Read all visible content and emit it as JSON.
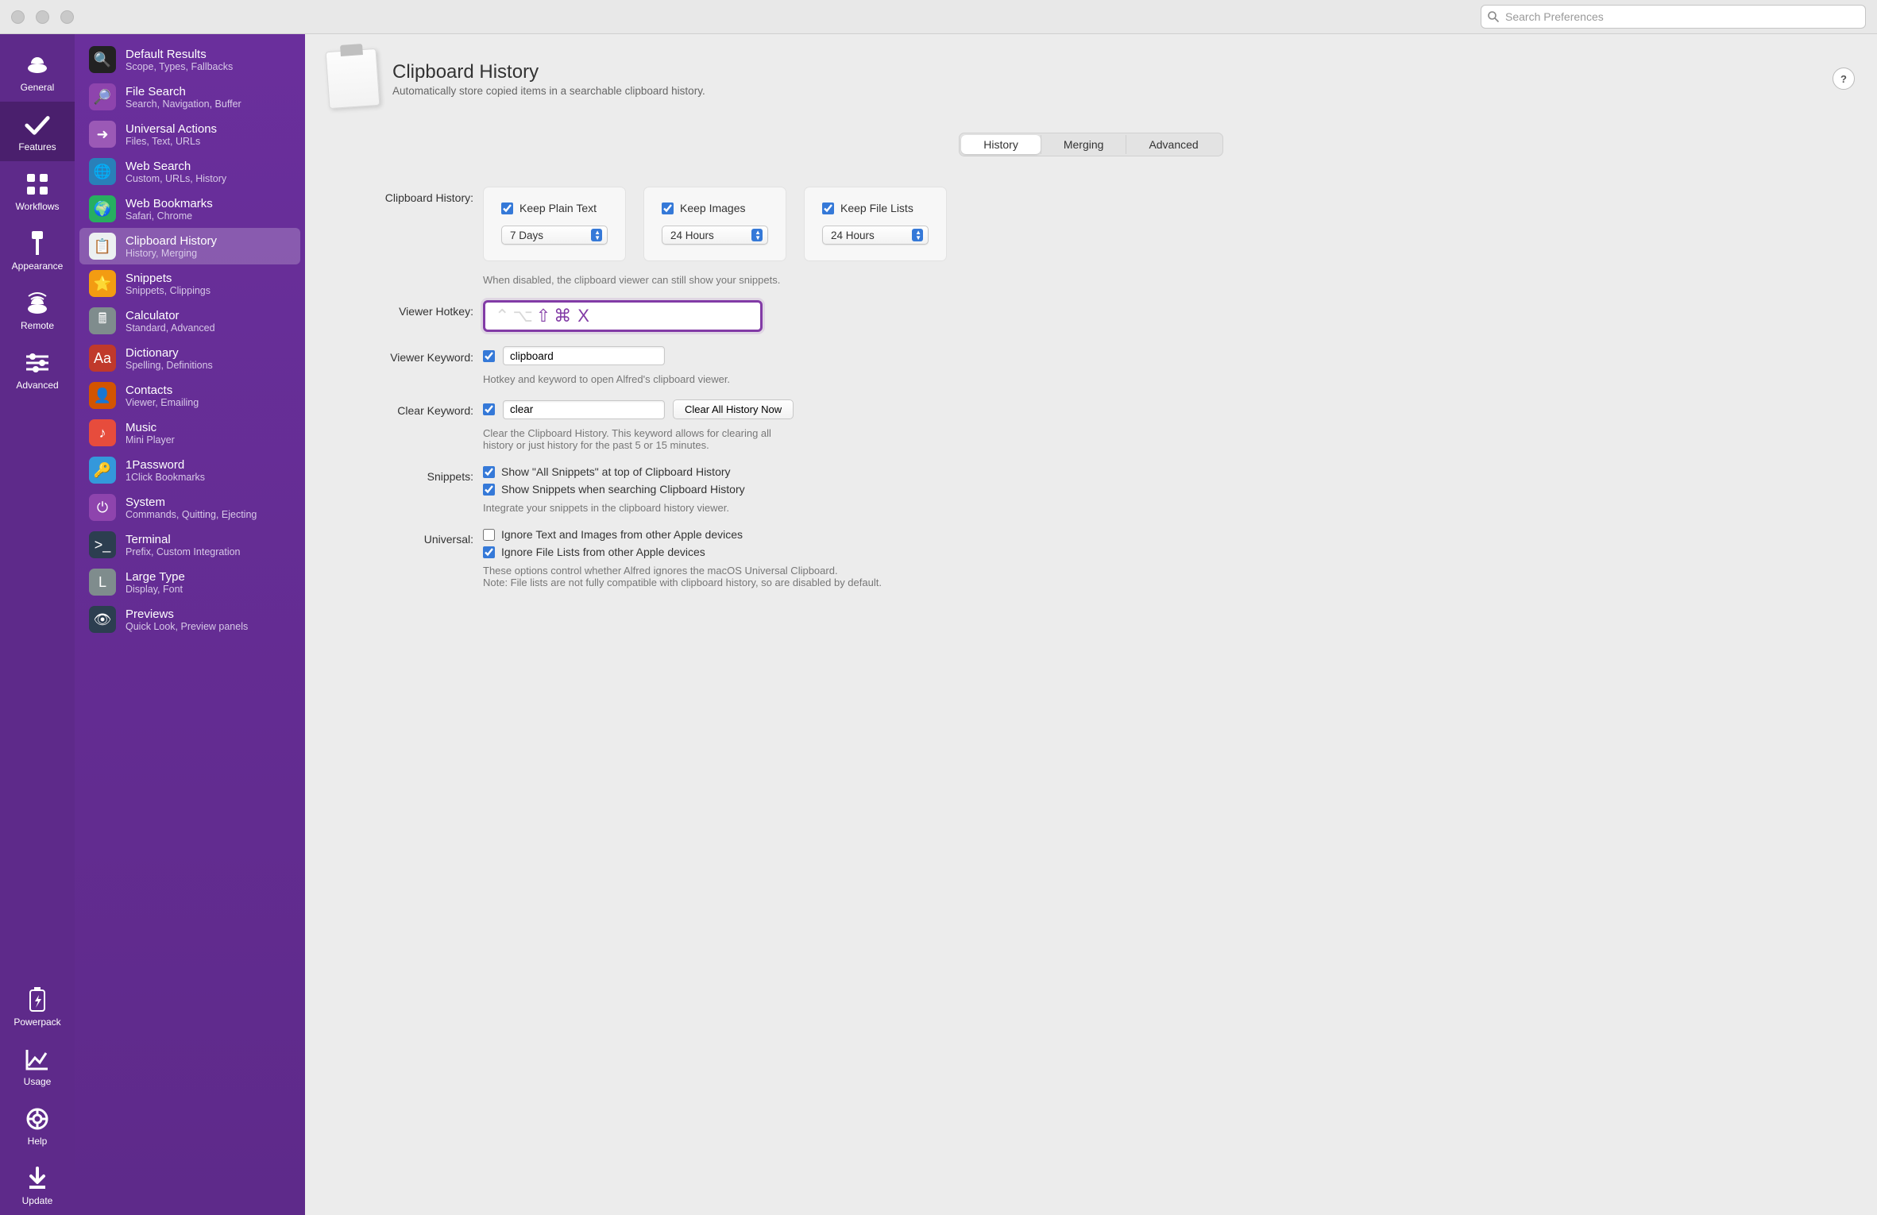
{
  "search_placeholder": "Search Preferences",
  "rail": [
    {
      "id": "general",
      "label": "General"
    },
    {
      "id": "features",
      "label": "Features"
    },
    {
      "id": "workflows",
      "label": "Workflows"
    },
    {
      "id": "appearance",
      "label": "Appearance"
    },
    {
      "id": "remote",
      "label": "Remote"
    },
    {
      "id": "advanced",
      "label": "Advanced"
    }
  ],
  "rail_bottom": [
    {
      "id": "powerpack",
      "label": "Powerpack"
    },
    {
      "id": "usage",
      "label": "Usage"
    },
    {
      "id": "help",
      "label": "Help"
    },
    {
      "id": "update",
      "label": "Update"
    }
  ],
  "features": [
    {
      "title": "Default Results",
      "sub": "Scope, Types, Fallbacks"
    },
    {
      "title": "File Search",
      "sub": "Search, Navigation, Buffer"
    },
    {
      "title": "Universal Actions",
      "sub": "Files, Text, URLs"
    },
    {
      "title": "Web Search",
      "sub": "Custom, URLs, History"
    },
    {
      "title": "Web Bookmarks",
      "sub": "Safari, Chrome"
    },
    {
      "title": "Clipboard History",
      "sub": "History, Merging"
    },
    {
      "title": "Snippets",
      "sub": "Snippets, Clippings"
    },
    {
      "title": "Calculator",
      "sub": "Standard, Advanced"
    },
    {
      "title": "Dictionary",
      "sub": "Spelling, Definitions"
    },
    {
      "title": "Contacts",
      "sub": "Viewer, Emailing"
    },
    {
      "title": "Music",
      "sub": "Mini Player"
    },
    {
      "title": "1Password",
      "sub": "1Click Bookmarks"
    },
    {
      "title": "System",
      "sub": "Commands, Quitting, Ejecting"
    },
    {
      "title": "Terminal",
      "sub": "Prefix, Custom Integration"
    },
    {
      "title": "Large Type",
      "sub": "Display, Font"
    },
    {
      "title": "Previews",
      "sub": "Quick Look, Preview panels"
    }
  ],
  "header": {
    "title": "Clipboard History",
    "subtitle": "Automatically store copied items in a searchable clipboard history."
  },
  "tabs": {
    "history": "History",
    "merging": "Merging",
    "advanced": "Advanced"
  },
  "labels": {
    "clipboard_history": "Clipboard History:",
    "viewer_hotkey": "Viewer Hotkey:",
    "viewer_keyword": "Viewer Keyword:",
    "clear_keyword": "Clear Keyword:",
    "snippets": "Snippets:",
    "universal": "Universal:"
  },
  "keep": {
    "plain_text": {
      "label": "Keep Plain Text",
      "value": "7 Days"
    },
    "images": {
      "label": "Keep Images",
      "value": "24 Hours"
    },
    "file_lists": {
      "label": "Keep File Lists",
      "value": "24 Hours"
    },
    "disabled_hint": "When disabled, the clipboard viewer can still show your snippets."
  },
  "hotkey": {
    "active": "⇧⌘ X",
    "inactive": "⌃ ⌥"
  },
  "viewer_keyword_value": "clipboard",
  "viewer_hint": "Hotkey and keyword to open Alfred's clipboard viewer.",
  "clear_keyword_value": "clear",
  "clear_button": "Clear All History Now",
  "clear_hint": "Clear the Clipboard History. This keyword allows for clearing all history or just history for the past 5 or 15 minutes.",
  "snippets_opts": {
    "all_top": "Show \"All Snippets\" at top of Clipboard History",
    "when_search": "Show Snippets when searching Clipboard History",
    "hint": "Integrate your snippets in the clipboard history viewer."
  },
  "universal_opts": {
    "ignore_text": "Ignore Text and Images from other Apple devices",
    "ignore_files": "Ignore File Lists from other Apple devices",
    "hint": "These options control whether Alfred ignores the macOS Universal Clipboard.\nNote: File lists are not fully compatible with clipboard history, so are disabled by default."
  }
}
